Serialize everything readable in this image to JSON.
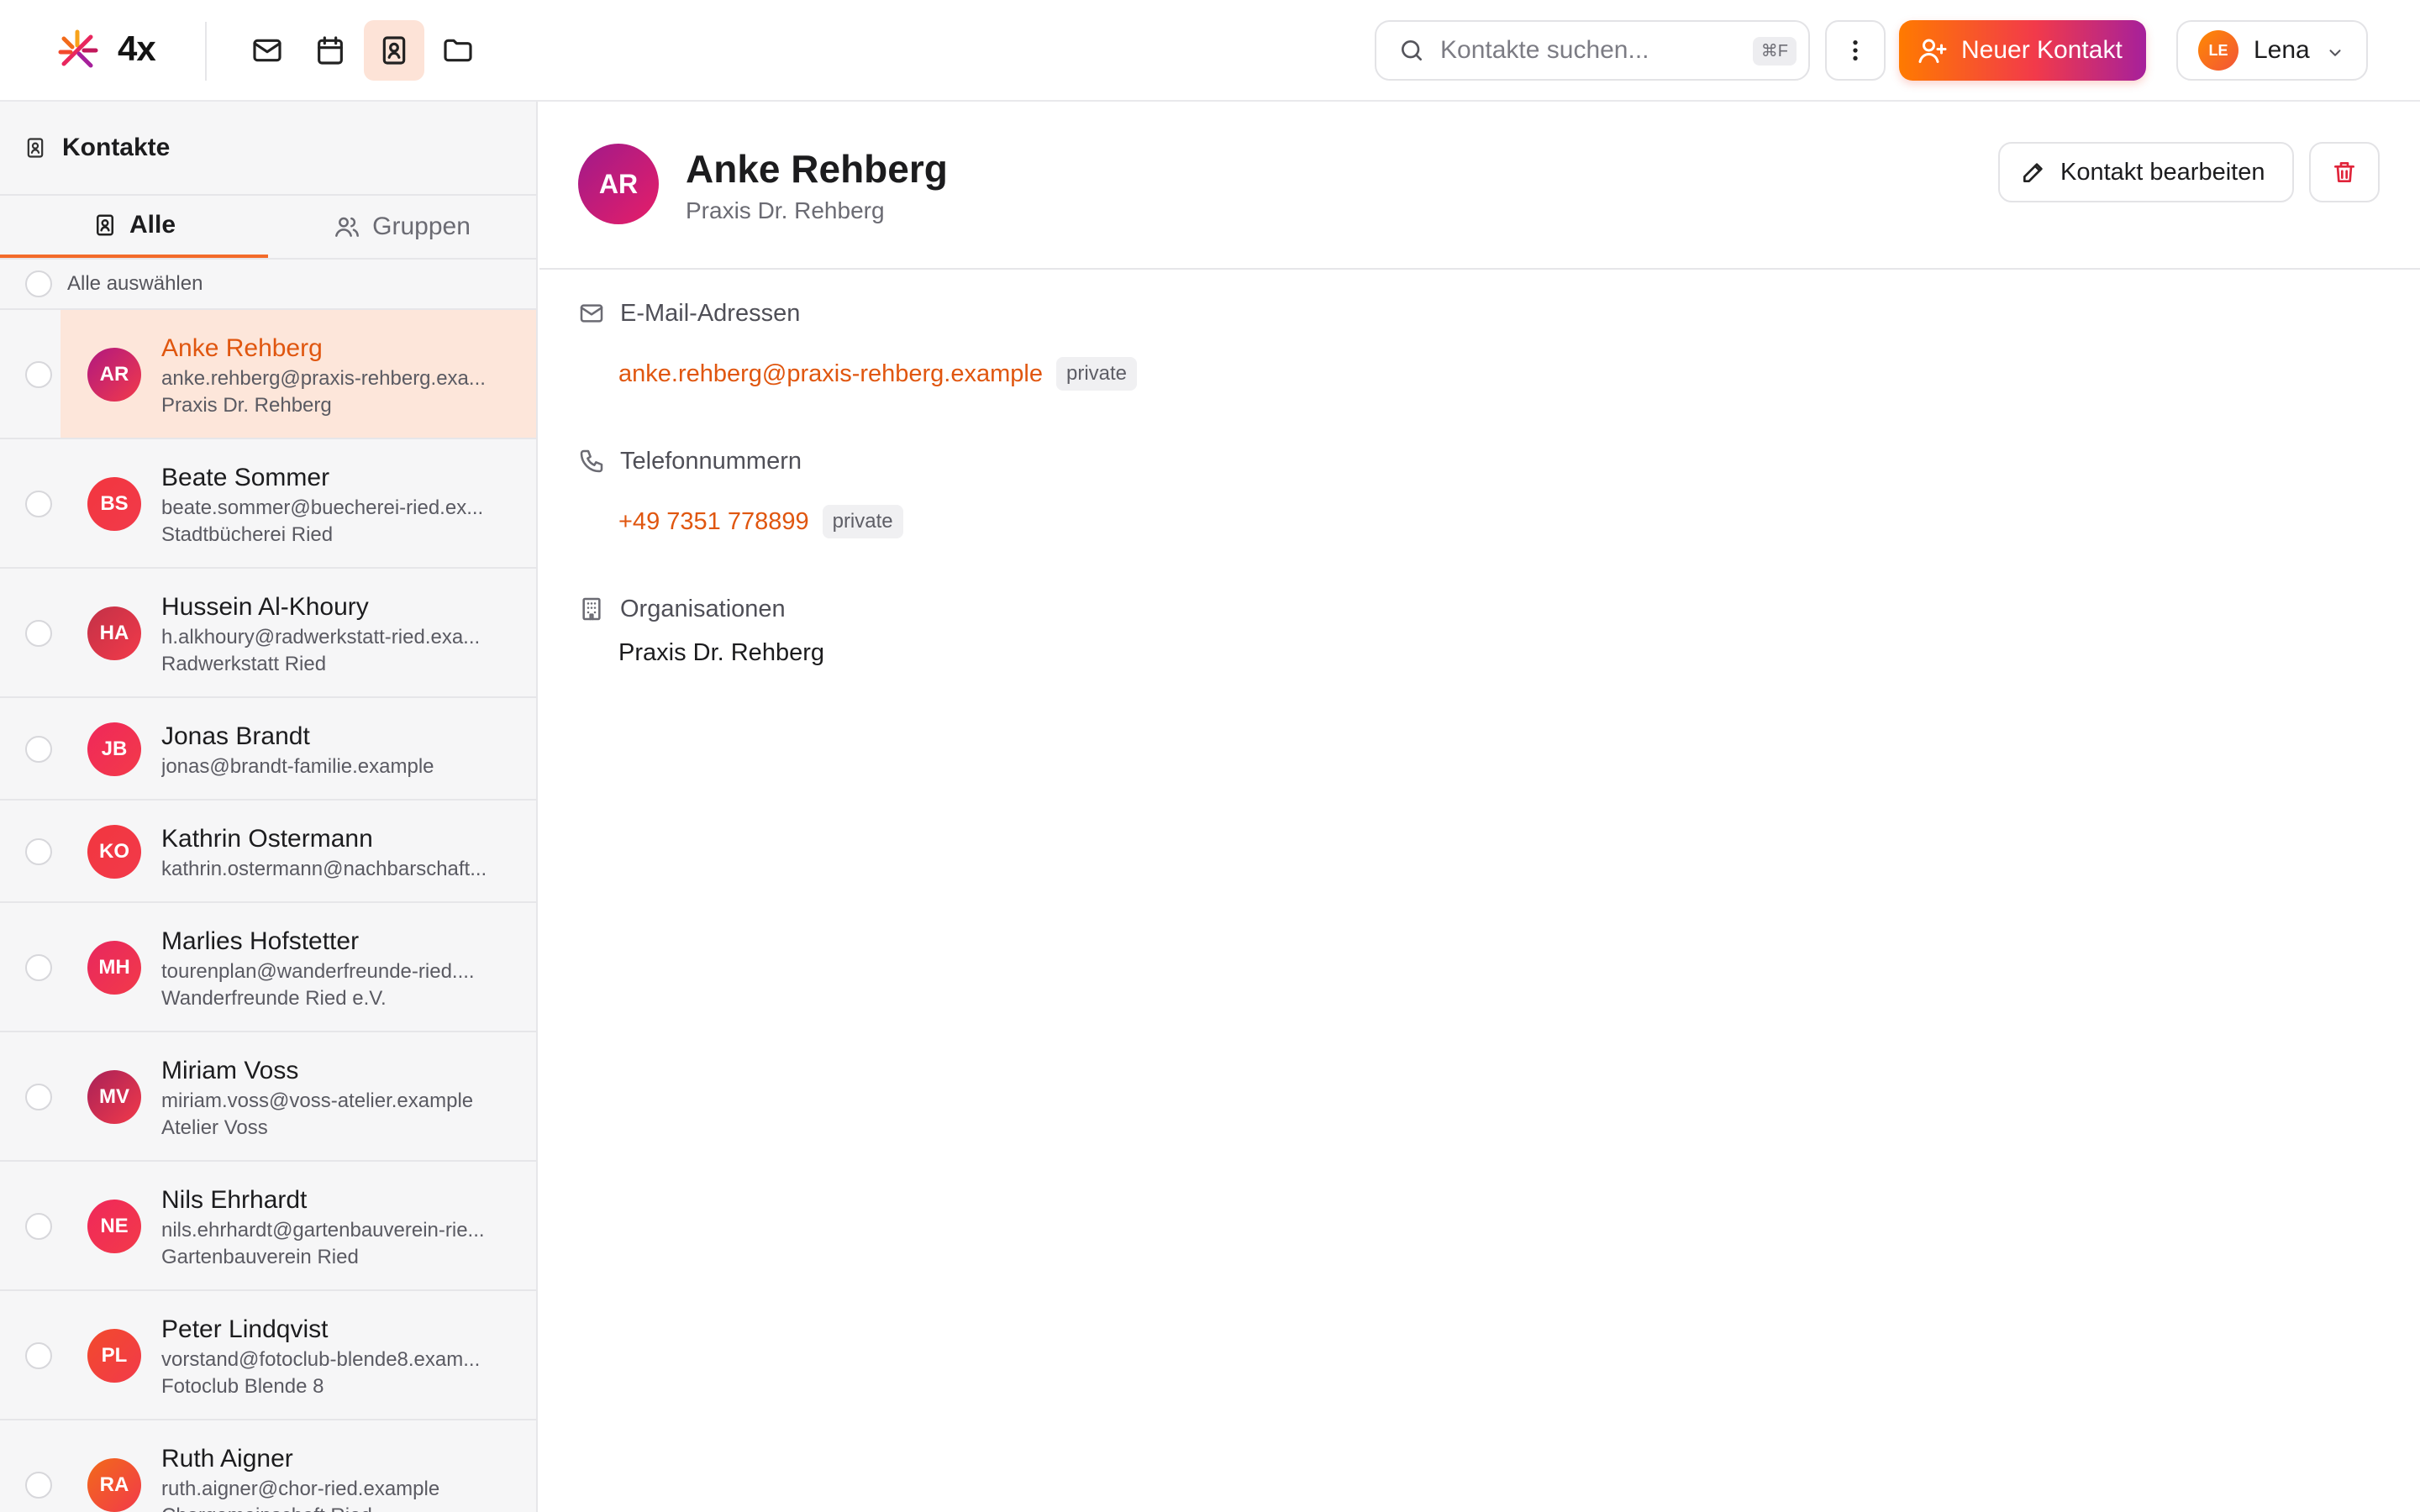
{
  "app": {
    "logo_text": "4x",
    "search": {
      "placeholder": "Kontakte suchen...",
      "shortcut": "⌘F"
    },
    "new_contact_label": "Neuer Kontakt",
    "user": {
      "initials": "LE",
      "name": "Lena"
    },
    "nav": [
      {
        "id": "mail",
        "icon": "mail-icon",
        "active": false
      },
      {
        "id": "calendar",
        "icon": "calendar-icon",
        "active": false
      },
      {
        "id": "contacts",
        "icon": "contacts-icon",
        "active": true
      },
      {
        "id": "files",
        "icon": "folder-icon",
        "active": false
      }
    ],
    "colors": {
      "accent": "#e0560f",
      "active_bg": "#fde6da",
      "gradient_start": "#ff7a00",
      "gradient_end": "#a6209b"
    }
  },
  "sidebar": {
    "title": "Kontakte",
    "tabs": [
      {
        "label": "Alle",
        "active": true
      },
      {
        "label": "Gruppen",
        "active": false
      }
    ],
    "select_all": "Alle auswählen",
    "contacts": [
      {
        "initials": "AR",
        "name": "Anke Rehberg",
        "email": "anke.rehberg@praxis-rehberg.exa...",
        "org": "Praxis Dr. Rehberg",
        "active": true,
        "color": "#b01880"
      },
      {
        "initials": "BS",
        "name": "Beate Sommer",
        "email": "beate.sommer@buecherei-ried.ex...",
        "org": "Stadtbücherei Ried",
        "active": false,
        "color": "#f2363f"
      },
      {
        "initials": "HA",
        "name": "Hussein Al-Khoury",
        "email": "h.alkhoury@radwerkstatt-ried.exa...",
        "org": "Radwerkstatt Ried",
        "active": false,
        "color": "#c23147"
      },
      {
        "initials": "JB",
        "name": "Jonas Brandt",
        "email": "jonas@brandt-familie.example",
        "org": "",
        "active": false,
        "color": "#f0285a"
      },
      {
        "initials": "KO",
        "name": "Kathrin Ostermann",
        "email": "kathrin.ostermann@nachbarschaft...",
        "org": "",
        "active": false,
        "color": "#f2363f"
      },
      {
        "initials": "MH",
        "name": "Marlies Hofstetter",
        "email": "tourenplan@wanderfreunde-ried....",
        "org": "Wanderfreunde Ried e.V.",
        "active": false,
        "color": "#e8275e"
      },
      {
        "initials": "MV",
        "name": "Miriam Voss",
        "email": "miriam.voss@voss-atelier.example",
        "org": "Atelier Voss",
        "active": false,
        "color": "#a82158"
      },
      {
        "initials": "NE",
        "name": "Nils Ehrhardt",
        "email": "nils.ehrhardt@gartenbauverein-rie...",
        "org": "Gartenbauverein Ried",
        "active": false,
        "color": "#f0285a"
      },
      {
        "initials": "PL",
        "name": "Peter Lindqvist",
        "email": "vorstand@fotoclub-blende8.exam...",
        "org": "Fotoclub Blende 8",
        "active": false,
        "color": "#f24a2c"
      },
      {
        "initials": "RA",
        "name": "Ruth Aigner",
        "email": "ruth.aigner@chor-ried.example",
        "org": "Chorgemeinschaft Ried",
        "active": false,
        "color": "#f26a1a"
      }
    ]
  },
  "detail": {
    "initials": "AR",
    "name": "Anke Rehberg",
    "org": "Praxis Dr. Rehberg",
    "edit_label": "Kontakt bearbeiten",
    "sections": {
      "email": {
        "title": "E-Mail-Adressen",
        "value": "anke.rehberg@praxis-rehberg.example",
        "tag": "private"
      },
      "phone": {
        "title": "Telefonnummern",
        "value": "+49 7351 778899",
        "tag": "private"
      },
      "org": {
        "title": "Organisationen",
        "value": "Praxis Dr. Rehberg"
      }
    }
  }
}
